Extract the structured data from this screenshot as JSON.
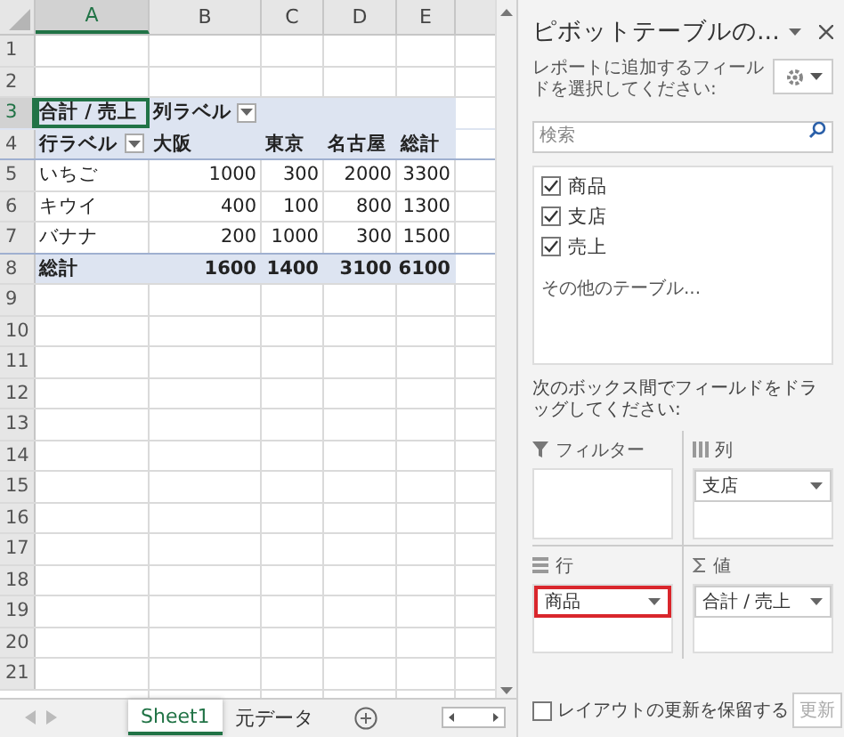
{
  "sheet": {
    "columns": [
      "A",
      "B",
      "C",
      "D",
      "E"
    ],
    "rows": [
      {
        "number": "1",
        "kind": "blank"
      },
      {
        "number": "2",
        "kind": "blank"
      },
      {
        "number": "3",
        "kind": "head",
        "cells": [
          {
            "text": "合計 / 売上",
            "selected": true
          },
          {
            "text": "列ラベル",
            "selected": false,
            "filter": true
          },
          {
            "text": "",
            "selected": false
          },
          {
            "text": "",
            "selected": false
          },
          {
            "text": "",
            "selected": false
          }
        ]
      },
      {
        "number": "4",
        "kind": "head",
        "cells": [
          {
            "text": "行ラベル",
            "selected": false,
            "filter": true
          },
          {
            "text": "大阪",
            "selected": false
          },
          {
            "text": "東京",
            "selected": false
          },
          {
            "text": "名古屋",
            "selected": false
          },
          {
            "text": "総計",
            "selected": false
          }
        ]
      },
      {
        "number": "5",
        "kind": "data",
        "cells": [
          {
            "text": "いちご",
            "selected": false
          },
          {
            "text": "1000",
            "selected": false
          },
          {
            "text": "300",
            "selected": false
          },
          {
            "text": "2000",
            "selected": false
          },
          {
            "text": "3300",
            "selected": false
          }
        ]
      },
      {
        "number": "6",
        "kind": "data",
        "cells": [
          {
            "text": "キウイ",
            "selected": false
          },
          {
            "text": "400",
            "selected": false
          },
          {
            "text": "100",
            "selected": false
          },
          {
            "text": "800",
            "selected": false
          },
          {
            "text": "1300",
            "selected": false
          }
        ]
      },
      {
        "number": "7",
        "kind": "data",
        "cells": [
          {
            "text": "バナナ",
            "selected": false
          },
          {
            "text": "200",
            "selected": false
          },
          {
            "text": "1000",
            "selected": false
          },
          {
            "text": "300",
            "selected": false
          },
          {
            "text": "1500",
            "selected": false
          }
        ]
      },
      {
        "number": "8",
        "kind": "total",
        "cells": [
          {
            "text": "総計",
            "selected": false
          },
          {
            "text": "1600",
            "selected": false
          },
          {
            "text": "1400",
            "selected": false
          },
          {
            "text": "3100",
            "selected": false
          },
          {
            "text": "6100",
            "selected": false
          }
        ]
      },
      {
        "number": "9",
        "kind": "blank"
      },
      {
        "number": "10",
        "kind": "blank"
      },
      {
        "number": "11",
        "kind": "blank"
      },
      {
        "number": "12",
        "kind": "blank"
      },
      {
        "number": "13",
        "kind": "blank"
      },
      {
        "number": "14",
        "kind": "blank"
      },
      {
        "number": "15",
        "kind": "blank"
      },
      {
        "number": "16",
        "kind": "blank"
      },
      {
        "number": "17",
        "kind": "blank"
      },
      {
        "number": "18",
        "kind": "blank"
      },
      {
        "number": "19",
        "kind": "blank"
      },
      {
        "number": "20",
        "kind": "blank"
      },
      {
        "number": "21",
        "kind": "blank"
      }
    ],
    "tabs": [
      {
        "label": "Sheet1",
        "selected": true
      },
      {
        "label": "元データ",
        "selected": false
      }
    ]
  },
  "pane": {
    "title": "ピボットテーブルの...",
    "instruction": "レポートに追加するフィールドを選択してください:",
    "search": {
      "placeholder": "検索"
    },
    "fields": [
      {
        "label": "商品",
        "checked": true
      },
      {
        "label": "支店",
        "checked": true
      },
      {
        "label": "売上",
        "checked": true
      }
    ],
    "more_tables": "その他のテーブル...",
    "drag_hint": "次のボックス間でフィールドをドラッグしてください:",
    "areas": [
      {
        "kind": "filter",
        "label": "フィルター"
      },
      {
        "kind": "columns",
        "label": "列",
        "items": [
          {
            "label": "支店",
            "highlighted": false
          }
        ]
      },
      {
        "kind": "rows",
        "label": "行",
        "items": [
          {
            "label": "商品",
            "highlighted": true
          }
        ]
      },
      {
        "kind": "values",
        "label": "値",
        "items": [
          {
            "label": "合計 / 売上",
            "highlighted": false
          }
        ]
      }
    ],
    "defer": {
      "label": "レイアウトの更新を保留する",
      "checked": false
    },
    "update_button": {
      "label": "更新",
      "disabled": true
    }
  }
}
